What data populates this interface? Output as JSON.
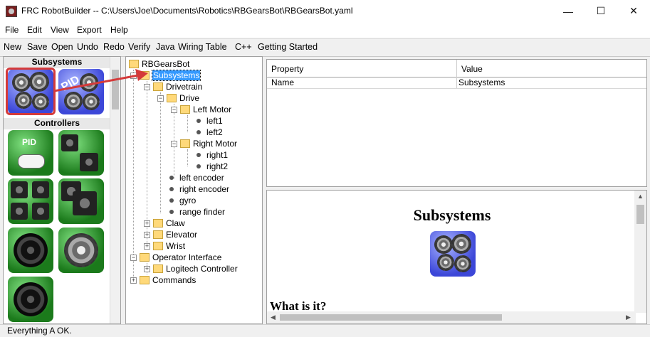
{
  "window": {
    "title": "FRC RobotBuilder -- C:\\Users\\Joe\\Documents\\Robotics\\RBGearsBot\\RBGearsBot.yaml",
    "controls": {
      "minimize": "—",
      "maximize": "☐",
      "close": "✕"
    }
  },
  "menu": [
    "File",
    "Edit",
    "View",
    "Export",
    "Help"
  ],
  "toolbar": [
    "New",
    "Save",
    "Open",
    "Undo",
    "Redo",
    "Verify",
    "Java",
    "Wiring Table",
    "C++",
    "Getting Started"
  ],
  "palette": {
    "subsystems_header": "Subsystems",
    "controllers_header": "Controllers",
    "pid_label": "PID",
    "subsystem_tiles": [
      {
        "icon": "subsystem-gears-icon",
        "color": "#3c47d8",
        "selected": true
      },
      {
        "icon": "pid-subsystem-icon",
        "color": "#3c47d8",
        "selected": false
      }
    ],
    "controller_tiles": [
      {
        "icon": "pid-controller-icon"
      },
      {
        "icon": "motor-controller-icon"
      },
      {
        "icon": "multi-motor-controller-icon"
      },
      {
        "icon": "robot-drive-icon"
      },
      {
        "icon": "wheel-icon"
      },
      {
        "icon": "mecanum-wheel-icon"
      },
      {
        "icon": "omni-wheel-icon"
      }
    ]
  },
  "tree": {
    "root": "RBGearsBot",
    "selected": "Subsystems",
    "items": {
      "subsystems": "Subsystems",
      "drivetrain": "Drivetrain",
      "drive": "Drive",
      "left_motor": "Left Motor",
      "left1": "left1",
      "left2": "left2",
      "right_motor": "Right Motor",
      "right1": "right1",
      "right2": "right2",
      "left_encoder": "left encoder",
      "right_encoder": "right encoder",
      "gyro": "gyro",
      "range_finder": "range finder",
      "claw": "Claw",
      "elevator": "Elevator",
      "wrist": "Wrist",
      "operator_interface": "Operator Interface",
      "logitech_controller": "Logitech Controller",
      "commands": "Commands"
    }
  },
  "properties": {
    "headers": {
      "property": "Property",
      "value": "Value"
    },
    "rows": [
      {
        "property": "Name",
        "value": "Subsystems"
      }
    ]
  },
  "help": {
    "title": "Subsystems",
    "section_heading": "What is it?"
  },
  "status": "Everything A OK.",
  "colors": {
    "selection": "#3399ff",
    "highlight_box": "#d43a3a",
    "tile_blue": "#3c47d8",
    "tile_green": "#1b7a1b"
  }
}
